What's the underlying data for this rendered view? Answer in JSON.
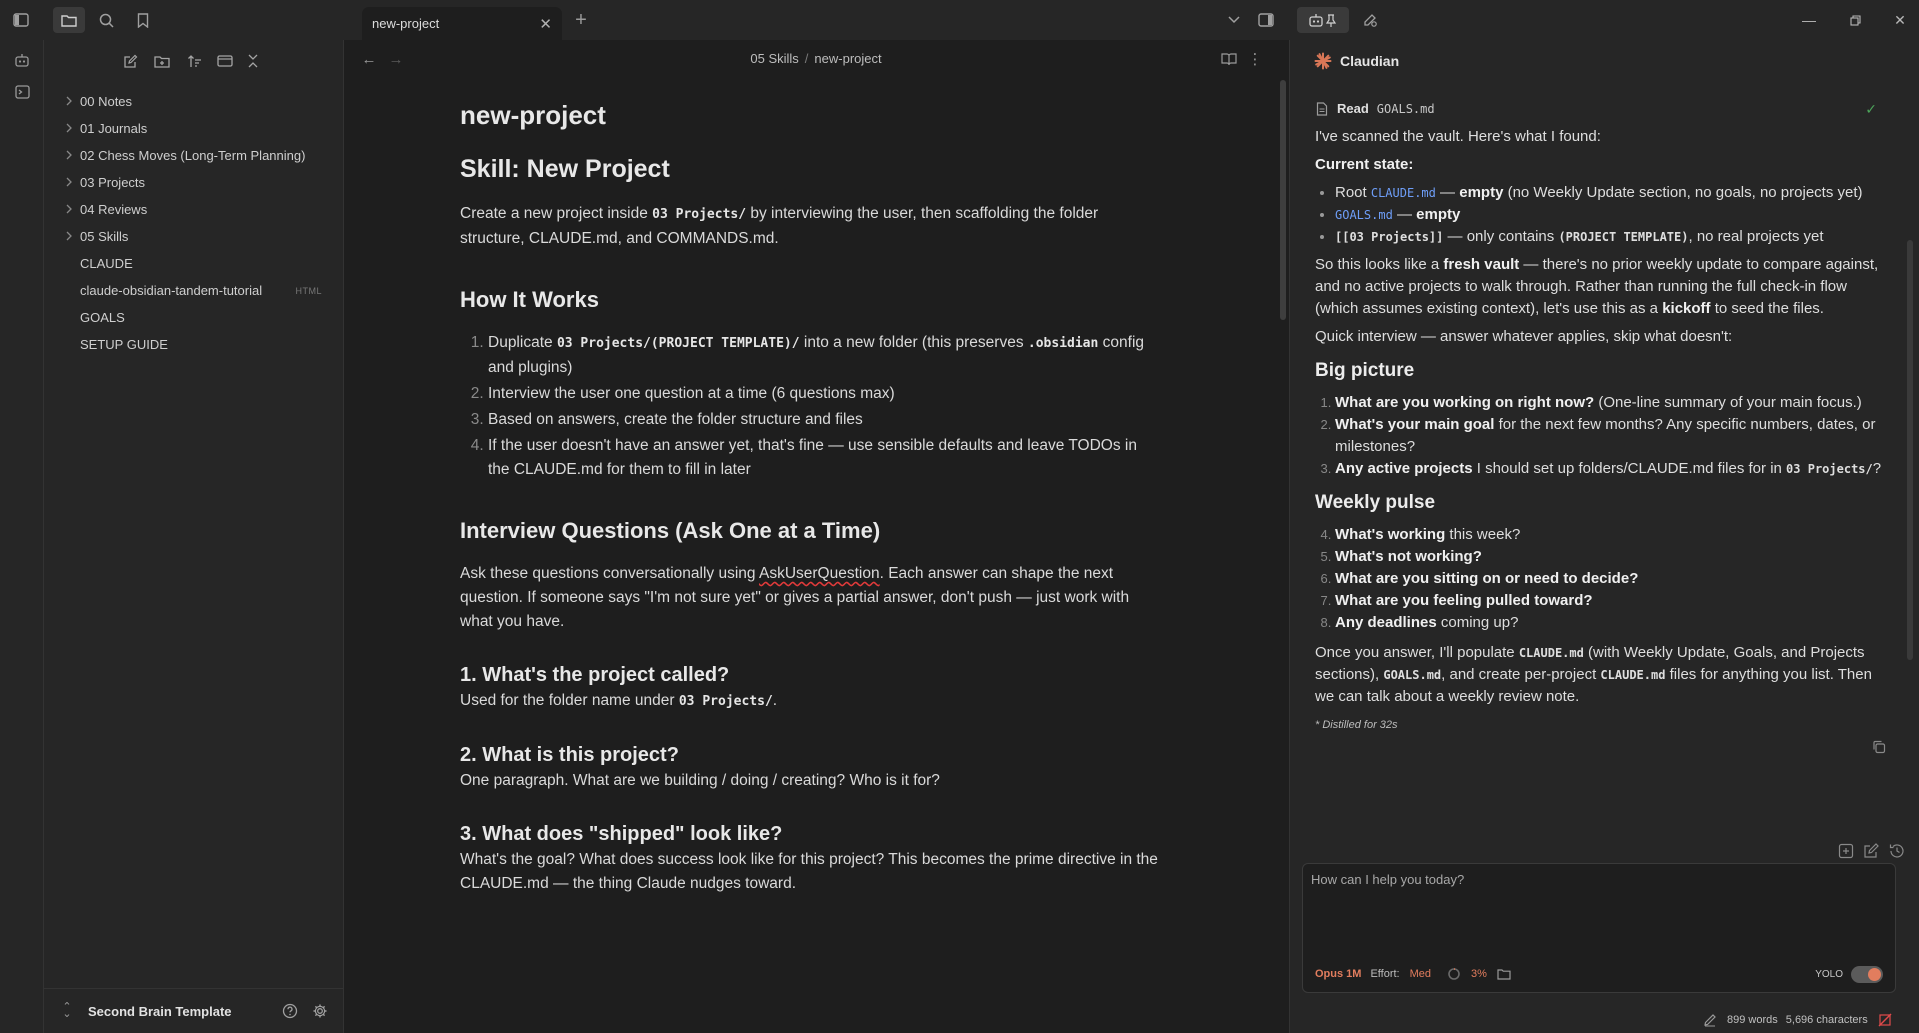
{
  "tabs": {
    "active_label": "new-project"
  },
  "explorer": {
    "items": [
      {
        "label": "00 Notes",
        "folder": true
      },
      {
        "label": "01 Journals",
        "folder": true
      },
      {
        "label": "02 Chess Moves (Long-Term Planning)",
        "folder": true
      },
      {
        "label": "03 Projects",
        "folder": true
      },
      {
        "label": "04 Reviews",
        "folder": true
      },
      {
        "label": "05 Skills",
        "folder": true
      },
      {
        "label": "CLAUDE",
        "folder": false
      },
      {
        "label": "claude-obsidian-tandem-tutorial",
        "folder": false,
        "badge": "HTML"
      },
      {
        "label": "GOALS",
        "folder": false
      },
      {
        "label": "SETUP GUIDE",
        "folder": false
      }
    ],
    "vault_name": "Second Brain Template"
  },
  "editor": {
    "breadcrumb": {
      "folder": "05 Skills",
      "sep": "/",
      "file": "new-project"
    },
    "doc": {
      "title": "new-project",
      "h1": "Skill: New Project",
      "intro": {
        "a": "Create a new project inside ",
        "code": "03 Projects/",
        "b": " by interviewing the user, then scaffolding the folder structure, CLAUDE.md, and COMMANDS.md."
      },
      "how_heading": "How It Works",
      "how_1": {
        "a": "Duplicate ",
        "code1": "03 Projects/(PROJECT TEMPLATE)/",
        "b": " into a new folder (this preserves ",
        "code2": ".obsidian",
        "c": " config and plugins)"
      },
      "how_2": "Interview the user one question at a time (6 questions max)",
      "how_3": "Based on answers, create the folder structure and files",
      "how_4": "If the user doesn't have an answer yet, that's fine — use sensible defaults and leave TODOs in the CLAUDE.md for them to fill in later",
      "iq_heading": "Interview Questions (Ask One at a Time)",
      "iq_intro": {
        "a": "Ask these questions conversationally using ",
        "tool": "AskUserQuestion",
        "b": ". Each answer can shape the next question. If someone says \"I'm not sure yet\" or gives a partial answer, don't push — just work with what you have."
      },
      "q1_heading": "1. What's the project called?",
      "q1_text": {
        "a": "Used for the folder name under ",
        "code": "03 Projects/",
        "b": "."
      },
      "q2_heading": "2. What is this project?",
      "q2_text": "One paragraph. What are we building / doing / creating? Who is it for?",
      "q3_heading": "3. What does \"shipped\" look like?",
      "q3_text": "What's the goal? What does success look like for this project? This becomes the prime directive in the CLAUDE.md — the thing Claude nudges toward."
    }
  },
  "claudian": {
    "title": "Claudian",
    "tool": {
      "name": "Read",
      "arg": "GOALS.md"
    },
    "intro": "I've scanned the vault. Here's what I found:",
    "current_state_label": "Current state:",
    "state_1": {
      "a": "Root ",
      "code": "CLAUDE.md",
      "b": " — ",
      "bold": "empty",
      "c": " (no Weekly Update section, no goals, no projects yet)"
    },
    "state_2": {
      "code": "GOALS.md",
      "b": " — ",
      "bold": "empty"
    },
    "state_3": {
      "code": "[[03 Projects]]",
      "b": " — only contains ",
      "code2": "(PROJECT TEMPLATE)",
      "c": ", no real projects yet"
    },
    "fresh": {
      "a": "So this looks like a ",
      "b1": "fresh vault",
      "b": " — there's no prior weekly update to compare against, and no active projects to walk through. Rather than running the full check-in flow (which assumes existing context), let's use this as a ",
      "b2": "kickoff",
      "c": " to seed the files."
    },
    "quick": "Quick interview — answer whatever applies, skip what doesn't:",
    "big_picture": "Big picture",
    "bp_1": {
      "bold": "What are you working on right now?",
      "rest": " (One-line summary of your main focus.)"
    },
    "bp_2": {
      "bold": "What's your main goal",
      "rest": " for the next few months? Any specific numbers, dates, or milestones?"
    },
    "bp_3": {
      "bold": "Any active projects",
      "rest": " I should set up folders/CLAUDE.md files for in ",
      "code": "03 Projects/",
      "end": "?"
    },
    "weekly_pulse": "Weekly pulse",
    "wp_4": {
      "bold": "What's working",
      "rest": " this week?"
    },
    "wp_5": {
      "bold": "What's not working?",
      "rest": ""
    },
    "wp_6": {
      "bold": "What are you sitting on or need to decide?",
      "rest": ""
    },
    "wp_7": {
      "bold": "What are you feeling pulled toward?",
      "rest": ""
    },
    "wp_8": {
      "bold": "Any deadlines",
      "rest": " coming up?"
    },
    "outro": {
      "a": "Once you answer, I'll populate ",
      "code1": "CLAUDE.md",
      "b": " (with Weekly Update, Goals, and Projects sections), ",
      "code2": "GOALS.md",
      "c": ", and create per-project ",
      "code3": "CLAUDE.md",
      "d": " files for anything you list. Then we can talk about a weekly review note."
    },
    "distilled": "* Distilled for 32s",
    "input_placeholder": "How can I help you today?",
    "model": "Opus 1M",
    "effort_label": "Effort:",
    "effort_value": "Med",
    "context_pct": "3%",
    "yolo_label": "YOLO",
    "yolo_on": true
  },
  "status": {
    "words": "899 words",
    "chars": "5,696 characters"
  },
  "colors": {
    "accent": "#e27d5e",
    "link": "#6e9ef8",
    "claude_logo": "#d97757"
  }
}
